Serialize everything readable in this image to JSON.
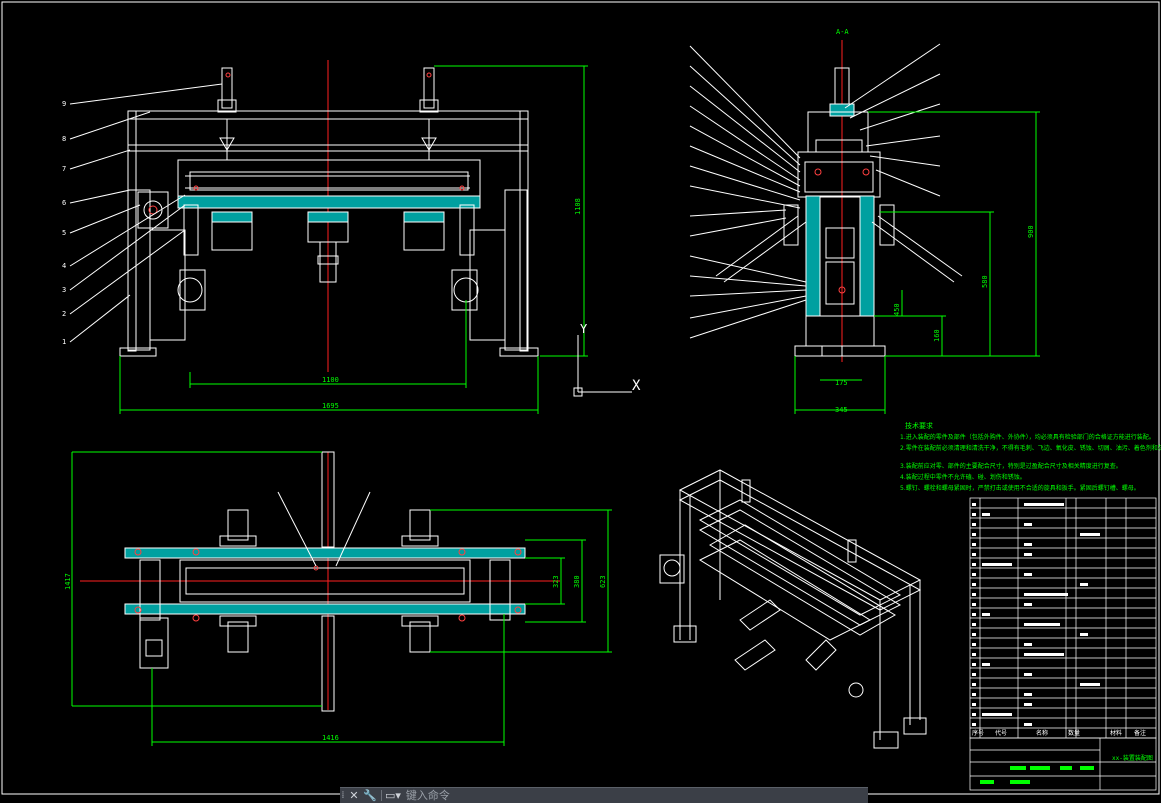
{
  "colors": {
    "background": "#000000",
    "line": "#ffffff",
    "centerline": "#ff2020",
    "dimension": "#00ff00",
    "fill": "#00a0a0",
    "accent": "#ff4040"
  },
  "front_view": {
    "dim_top": "1108",
    "dim_inner": "1100",
    "dim_overall": "1695",
    "leaders": [
      "9",
      "8",
      "7",
      "6",
      "5",
      "4",
      "3",
      "2",
      "1"
    ]
  },
  "side_view": {
    "section_label": "A-A",
    "dim_height": "900",
    "dim_mid": "580",
    "dim_low": "160",
    "dim_small": "450",
    "dim_center": "175",
    "dim_base": "345"
  },
  "top_view": {
    "dim_width": "1416",
    "dim_height": "1417",
    "dim_right1": "623",
    "dim_right2": "380",
    "dim_right3": "323"
  },
  "ucs": {
    "x_label": "X",
    "y_label": "Y"
  },
  "tech_notes": {
    "title": "技术要求",
    "lines": [
      "1.进入装配的零件及部件（包括外购件、外协件），均必须具有检验部门的合格证方能进行装配。",
      "2.零件在装配前必须清理和清洗干净，不得有毛刺、飞边、氧化皮、锈蚀、切屑、油污、着色剂和灰尘等。",
      "3.装配前应对零、部件的主要配合尺寸，特别是过盈配合尺寸及相关精度进行复查。",
      "4.装配过程中零件不允许磕、碰、划伤和锈蚀。",
      "5.螺钉、螺栓和螺母紧固时，严禁打击或使用不合适的旋具和扳手。紧固后螺钉槽、螺母。"
    ]
  },
  "title_block": {
    "drawing_name": "xx-装置装配图",
    "headers": [
      "序号",
      "代号",
      "名称",
      "数量",
      "材料",
      "备注"
    ]
  },
  "command_line": {
    "placeholder": "键入命令",
    "close_icon": "close-icon",
    "settings_icon": "wrench-icon",
    "prompt_icon": "command-prompt-icon"
  }
}
